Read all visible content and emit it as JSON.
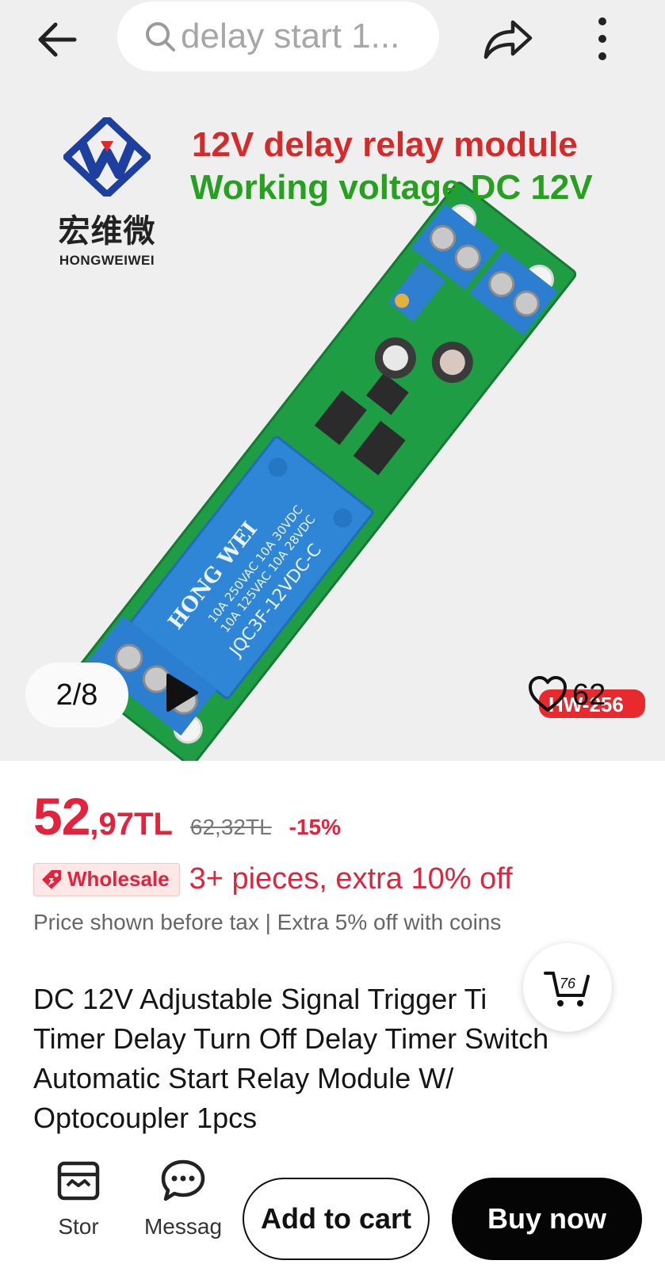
{
  "search": {
    "text": "delay start 1..."
  },
  "gallery": {
    "brand_cn": "宏维微",
    "brand_en": "HONGWEIWEI",
    "headline1": "12V delay relay module",
    "headline2": "Working voltage DC 12V",
    "relay_text": [
      "HONG WEI",
      "10A 250VAC 10A 30VDC",
      "10A 125VAC 10A 28VDC",
      "JQC3F-12VDC-C"
    ],
    "counter": "2/8",
    "favorites": "62",
    "model_sticker": "HW-256"
  },
  "price": {
    "integer": "52",
    "decimal": ",97TL",
    "original": "62,32TL",
    "discount": "-15%"
  },
  "wholesale": {
    "label": "Wholesale",
    "text": "3+ pieces, extra 10% off"
  },
  "tax_note": "Price shown before tax | Extra 5% off with coins",
  "title_lines": [
    "DC 12V Adjustable Signal Trigger Ti",
    "Timer Delay Turn Off Delay Timer Switch",
    "Automatic Start Relay Module W/",
    "Optocoupler 1pcs"
  ],
  "cart_float": {
    "count": "76"
  },
  "bottom_nav": {
    "store": "Stor",
    "messages": "Messag",
    "add_to_cart": "Add to cart",
    "buy_now": "Buy now"
  },
  "colors": {
    "accent_red": "#e4223c",
    "headline_red": "#d42a2a",
    "headline_green": "#25a01f",
    "buy_button": "#050505"
  }
}
